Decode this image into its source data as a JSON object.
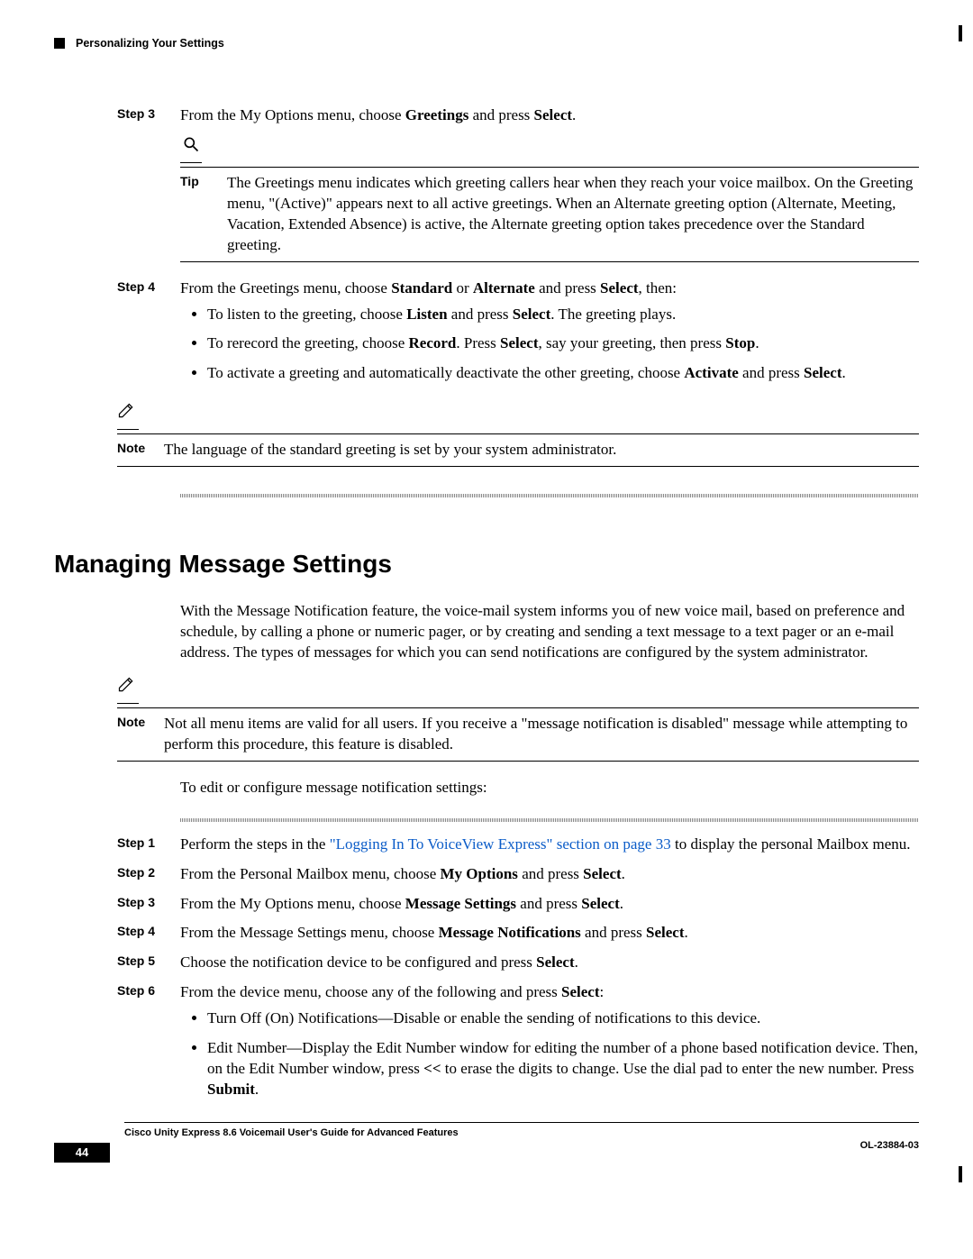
{
  "header": {
    "chapter_title": "Personalizing Your Settings"
  },
  "step3": {
    "label": "Step 3",
    "t1": "From the My Options menu, choose ",
    "b1": "Greetings",
    "t2": " and press ",
    "b2": "Select",
    "t3": "."
  },
  "tip": {
    "label": "Tip",
    "text": "The Greetings menu indicates which greeting callers hear when they reach your voice mailbox. On the Greeting menu, \"(Active)\" appears next to all active greetings. When an Alternate greeting option (Alternate, Meeting, Vacation, Extended Absence) is active, the Alternate greeting option takes precedence over the Standard greeting."
  },
  "step4": {
    "label": "Step 4",
    "t1": "From the Greetings menu, choose ",
    "b1": "Standard",
    "t2": " or ",
    "b2": "Alternate",
    "t3": " and press ",
    "b3": "Select",
    "t4": ", then:",
    "li1_a": "To listen to the greeting, choose ",
    "li1_b1": "Listen",
    "li1_c": " and press ",
    "li1_b2": "Select",
    "li1_d": ". The greeting plays.",
    "li2_a": "To rerecord the greeting, choose ",
    "li2_b1": "Record",
    "li2_c": ". Press ",
    "li2_b2": "Select",
    "li2_d": ", say your greeting, then press ",
    "li2_b3": "Stop",
    "li2_e": ".",
    "li3_a": "To activate a greeting and automatically deactivate the other greeting, choose ",
    "li3_b1": "Activate",
    "li3_c": " and press ",
    "li3_b2": "Select",
    "li3_d": "."
  },
  "note1": {
    "label": "Note",
    "text": "The language of the standard greeting is set by your system administrator."
  },
  "section2": {
    "title": "Managing Message Settings",
    "intro": "With the Message Notification feature, the voice-mail system informs you of new voice mail, based on preference and schedule, by calling a phone or numeric pager, or by creating and sending a text message to a text pager or an e-mail address. The types of messages for which you can send notifications are configured by the system administrator."
  },
  "note2": {
    "label": "Note",
    "text": "Not all menu items are valid for all users. If you receive a \"message notification is disabled\" message while attempting to perform this procedure, this feature is disabled."
  },
  "lead": "To edit or configure message notification settings:",
  "s1": {
    "label": "Step 1",
    "a": "Perform the steps in the ",
    "link": "\"Logging In To VoiceView Express\" section on page 33",
    "b": " to display the personal Mailbox menu."
  },
  "s2": {
    "label": "Step 2",
    "a": "From the Personal Mailbox menu, choose ",
    "b1": "My Options",
    "c": " and press ",
    "b2": "Select",
    "d": "."
  },
  "s3": {
    "label": "Step 3",
    "a": "From the My Options menu, choose ",
    "b1": "Message Settings",
    "c": " and press ",
    "b2": "Select",
    "d": "."
  },
  "s4": {
    "label": "Step 4",
    "a": "From the Message Settings menu, choose ",
    "b1": "Message Notifications",
    "c": " and press ",
    "b2": "Select",
    "d": "."
  },
  "s5": {
    "label": "Step 5",
    "a": "Choose the notification device to be configured and press ",
    "b1": "Select",
    "d": "."
  },
  "s6": {
    "label": "Step 6",
    "a": "From the device menu, choose any of the following and press ",
    "b1": "Select",
    "d": ":",
    "li1": "Turn Off (On) Notifications—Disable or enable the sending of notifications to this device.",
    "li2_a": "Edit Number—Display the Edit Number window for editing the number of a phone based notification device. Then, on the Edit Number window, press ",
    "li2_b1": "<<",
    "li2_b": " to erase the digits to change. Use the dial pad to enter the new number. Press ",
    "li2_b2": "Submit",
    "li2_c": "."
  },
  "footer": {
    "title": "Cisco Unity Express 8.6 Voicemail User's Guide for Advanced Features",
    "page": "44",
    "docid": "OL-23884-03"
  }
}
